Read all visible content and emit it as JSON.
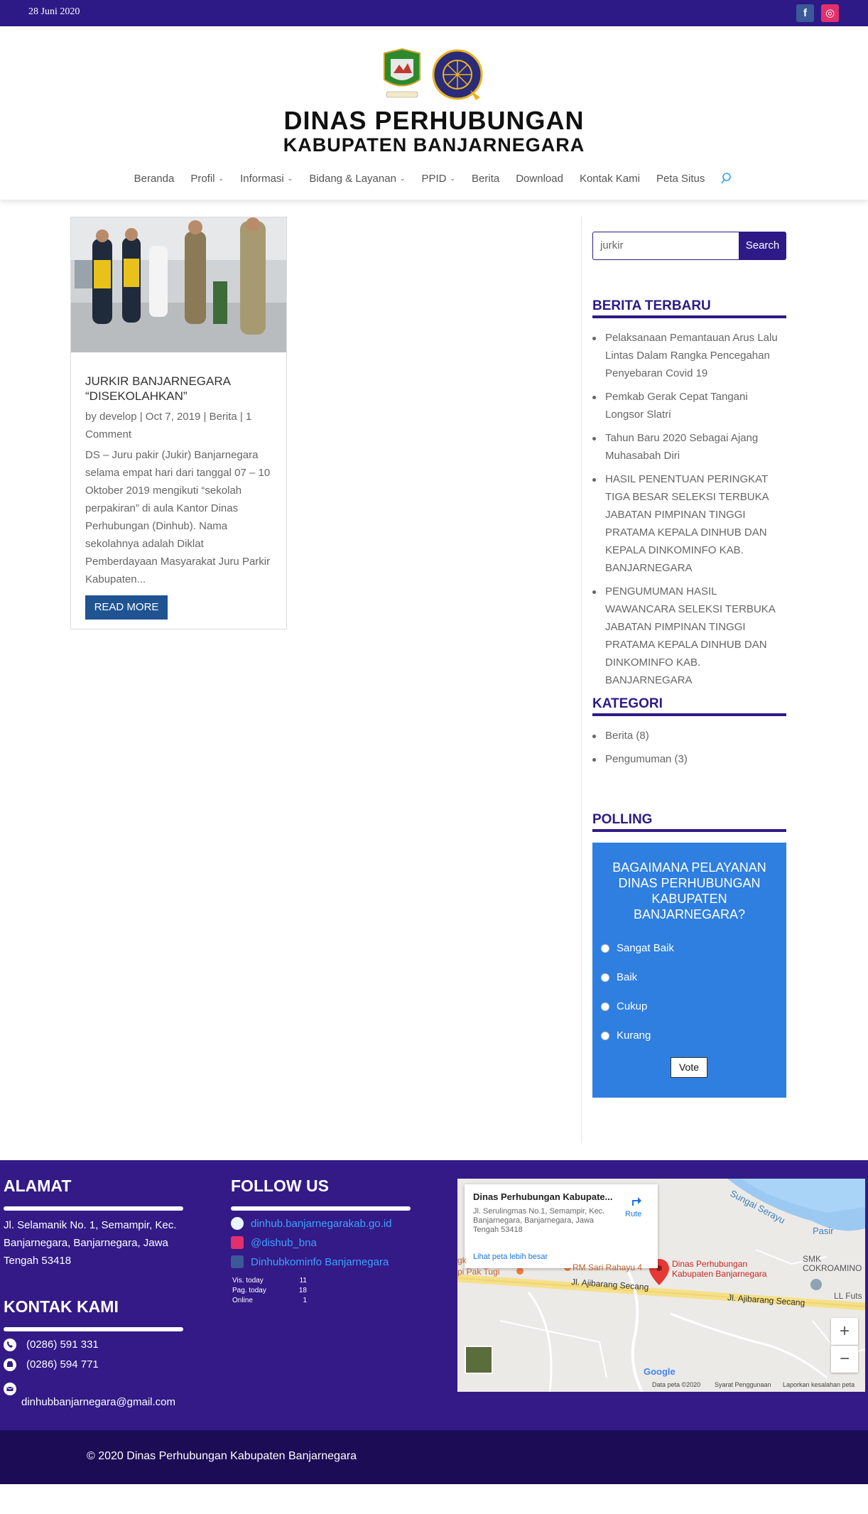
{
  "topbar": {
    "date": "28 Juni 2020",
    "facebook_glyph": "f",
    "instagram_glyph": "◎"
  },
  "header": {
    "title": "DINAS PERHUBUNGAN",
    "subtitle": "KABUPATEN BANJARNEGARA",
    "nav": [
      {
        "label": "Beranda",
        "caret": ""
      },
      {
        "label": "Profil",
        "caret": "⌄"
      },
      {
        "label": "Informasi",
        "caret": "⌄"
      },
      {
        "label": "Bidang & Layanan",
        "caret": "⌄"
      },
      {
        "label": "PPID",
        "caret": "⌄"
      },
      {
        "label": "Berita",
        "caret": ""
      },
      {
        "label": "Download",
        "caret": ""
      },
      {
        "label": "Kontak Kami",
        "caret": ""
      },
      {
        "label": "Peta Situs",
        "caret": ""
      }
    ]
  },
  "post": {
    "title": "JURKIR BANJARNEGARA “DISEKOLAHKAN”",
    "meta": "by develop | Oct 7, 2019 | Berita | 1 Comment",
    "excerpt": "DS – Juru pakir (Jukir) Banjarnegara selama empat hari dari tanggal 07 – 10 Oktober 2019 mengikuti “sekolah perpakiran” di aula Kantor Dinas Perhubungan (Dinhub). Nama sekolahnya adalah Diklat Pemberdayaan Masyarakat Juru Parkir Kabupaten...",
    "read_more": "READ MORE"
  },
  "sidebar": {
    "search_value": "jurkir",
    "search_button": "Search",
    "berita_title": "BERITA TERBARU",
    "berita": [
      "Pelaksanaan Pemantauan Arus Lalu Lintas Dalam Rangka Pencegahan Penyebaran Covid 19",
      "Pemkab Gerak Cepat Tangani Longsor Slatri",
      "Tahun Baru 2020 Sebagai Ajang Muhasabah Diri",
      "HASIL PENENTUAN PERINGKAT TIGA BESAR SELEKSI TERBUKA JABATAN PIMPINAN TINGGI PRATAMA KEPALA DINHUB DAN KEPALA DINKOMINFO KAB. BANJARNEGARA",
      "PENGUMUMAN HASIL WAWANCARA SELEKSI TERBUKA JABATAN PIMPINAN TINGGI PRATAMA KEPALA DINHUB DAN DINKOMINFO KAB. BANJARNEGARA"
    ],
    "kategori_title": "KATEGORI",
    "kategori": [
      "Berita (8)",
      "Pengumuman (3)"
    ],
    "polling_title": "POLLING",
    "poll_question": "BAGAIMANA PELAYANAN DINAS PERHUBUNGAN KABUPATEN BANJARNEGARA?",
    "poll_options": [
      "Sangat Baik",
      "Baik",
      "Cukup",
      "Kurang"
    ],
    "vote": "Vote"
  },
  "footer": {
    "alamat_title": "ALAMAT",
    "alamat": "Jl. Selamanik No. 1, Semampir, Kec. Banjarnegara, Banjarnegara, Jawa Tengah 53418",
    "kontak_title": "KONTAK KAMI",
    "phone": "(0286) 591 331",
    "fax": "(0286) 594 771",
    "email": "dinhubbanjarnegara@gmail.com",
    "follow_title": "FOLLOW US",
    "links": [
      "dinhub.banjarnegarakab.go.id",
      "@dishub_bna",
      "Dinhubkominfo Banjarnegara"
    ],
    "stats": [
      {
        "label": "Vis. today",
        "value": "11"
      },
      {
        "label": "Pag. today",
        "value": "18"
      },
      {
        "label": "Online",
        "value": "1"
      }
    ],
    "map": {
      "place": "Dinas Perhubungan Kabupate...",
      "address": "Jl. Serulingmas No.1, Semampir, Kec. Banjarnegara, Banjarnegara, Jawa Tengah 53418",
      "rute": "Rute",
      "larger": "Lihat peta lebih besar",
      "marker_label_1": "Dinas Perhubungan",
      "marker_label_2": "Kabupaten Banjarnegara",
      "label_rm": "RM Sari Rahayu 4",
      "label_road1": "Jl. Ajibarang Secang",
      "label_road2": "Jl. Ajibarang Secang",
      "label_river": "Sungai Serayu",
      "label_pasir": "Pasir",
      "label_smk": "SMK",
      "label_cokro": "COKROAMINO",
      "label_ll": "LL Futs",
      "label_pak": "pi Pak Tugi",
      "label_gk": "gk",
      "google": "Google",
      "footer_data": "Data peta ©2020",
      "footer_terms": "Syarat Penggunaan",
      "footer_report": "Laporkan kesalahan peta",
      "zoom_in": "+",
      "zoom_out": "−"
    },
    "copyright": "© 2020 Dinas Perhubungan Kabupaten Banjarnegara"
  }
}
